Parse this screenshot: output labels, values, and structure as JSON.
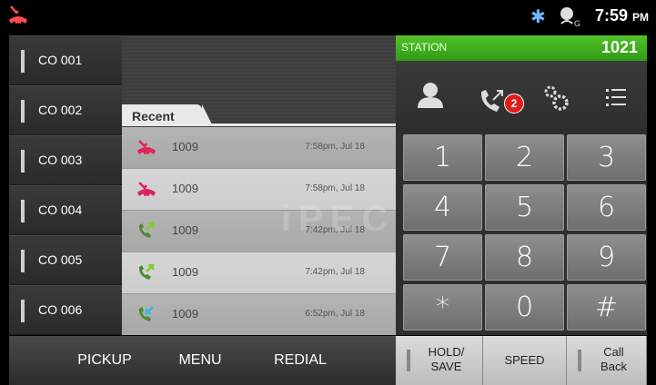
{
  "status_bar": {
    "time": "7:59",
    "ampm": "PM",
    "icons": [
      "missed-call-icon",
      "bluetooth-icon",
      "signal-icon"
    ]
  },
  "co_lines": [
    {
      "label": "CO 001"
    },
    {
      "label": "CO 002"
    },
    {
      "label": "CO 003"
    },
    {
      "label": "CO 004"
    },
    {
      "label": "CO 005"
    },
    {
      "label": "CO 006"
    }
  ],
  "recent": {
    "tab_label": "Recent",
    "watermark": "iPECS",
    "calls": [
      {
        "number": "1009",
        "time": "7:58pm, Jul 18",
        "type": "missed",
        "icon": "missed-call-icon"
      },
      {
        "number": "1009",
        "time": "7:58pm, Jul 18",
        "type": "missed",
        "icon": "missed-call-icon"
      },
      {
        "number": "1009",
        "time": "7:42pm, Jul 18",
        "type": "outgoing",
        "icon": "outgoing-call-icon"
      },
      {
        "number": "1009",
        "time": "7:42pm, Jul 18",
        "type": "outgoing",
        "icon": "outgoing-call-icon"
      },
      {
        "number": "1009",
        "time": "6:52pm, Jul 18",
        "type": "incoming",
        "icon": "incoming-call-icon"
      }
    ]
  },
  "station": {
    "label": "STATION",
    "extension": "1021"
  },
  "toolbar": {
    "badge_count": "2",
    "icons": [
      "contact-icon",
      "call-log-icon",
      "settings-icon",
      "menu-list-icon"
    ]
  },
  "keypad": {
    "keys": [
      "1",
      "2",
      "3",
      "4",
      "5",
      "6",
      "7",
      "8",
      "9",
      "*",
      "0",
      "#"
    ]
  },
  "bottom_bar": {
    "pickup": "PICKUP",
    "menu": "MENU",
    "redial": "REDIAL",
    "hold_save_line1": "HOLD/",
    "hold_save_line2": "SAVE",
    "speed": "SPEED",
    "call_back_line1": "Call",
    "call_back_line2": "Back"
  },
  "colors": {
    "station_green": "#3ea81c",
    "missed_red": "#e0245a",
    "outgoing_green": "#7ccf2a",
    "incoming_blue": "#39b6e8",
    "badge_red": "#e21a1a"
  }
}
